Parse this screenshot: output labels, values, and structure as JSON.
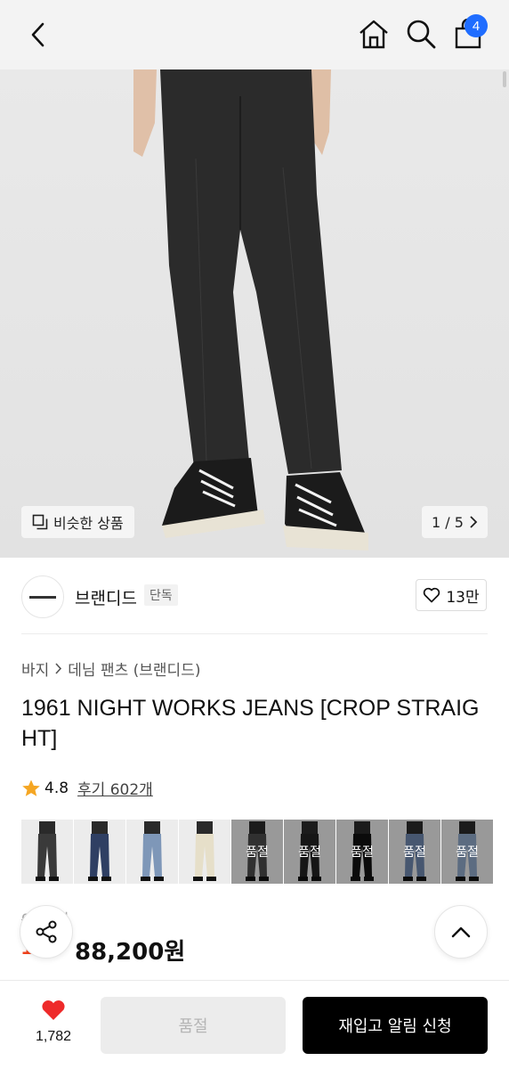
{
  "header": {
    "back_icon": "chevron-left-icon",
    "home_icon": "home-icon",
    "search_icon": "search-icon",
    "cart_icon": "shopping-bag-icon",
    "cart_count": "4",
    "badge_color": "#1f6dff"
  },
  "hero": {
    "similar_label": "비슷한 상품",
    "page_indicator": "1 / 5"
  },
  "brand": {
    "name": "브랜디드",
    "tag": "단독",
    "like_count": "13만"
  },
  "product": {
    "breadcrumb": [
      "바지",
      "데님 팬츠 (브랜디드)"
    ],
    "title": "1961 NIGHT WORKS JEANS [CROP STRAIGHT]",
    "rating": "4.8",
    "reviews": "후기 602개",
    "star_color": "#f5a623",
    "original_price": "9",
    "original_price_suffix": "9원",
    "discount": "1",
    "price": "88,200원",
    "discount_color": "#f2421b"
  },
  "variants": [
    {
      "label": "",
      "color": "#3a3a3a"
    },
    {
      "label": "",
      "color": "#2f3f63"
    },
    {
      "label": "",
      "color": "#7e97b8"
    },
    {
      "label": "",
      "color": "#e6dfc9"
    },
    {
      "label": "품절",
      "color": "#4a4a4a"
    },
    {
      "label": "품절",
      "color": "#222222"
    },
    {
      "label": "품절",
      "color": "#111111"
    },
    {
      "label": "품절",
      "color": "#6d86ad"
    },
    {
      "label": "품절",
      "color": "#8ea6c7"
    }
  ],
  "bottom": {
    "favorite_count": "1,782",
    "soldout_label": "품절",
    "restock_label": "재입고 알림 신청"
  }
}
